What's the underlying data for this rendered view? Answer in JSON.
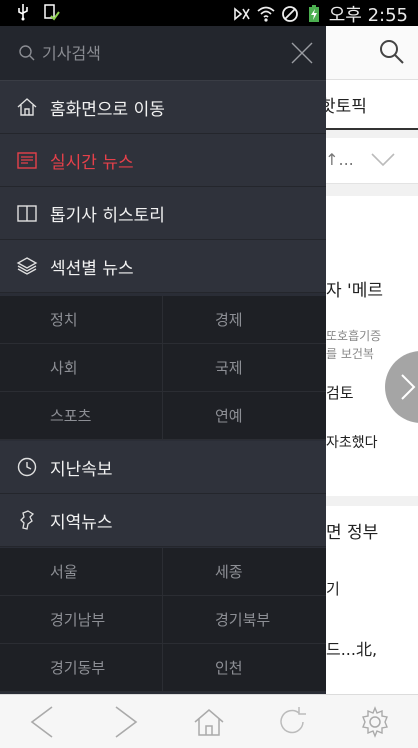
{
  "statusbar": {
    "time": "오후 2:55",
    "icons": [
      "usb-icon",
      "download-done-icon",
      "mute-icon",
      "wifi-icon",
      "block-icon",
      "battery-charging-icon"
    ]
  },
  "background_page": {
    "tab_label": "핫토픽",
    "select_value": "·↑...",
    "snippets": [
      "자 '메르",
      "또호흡기증",
      "를 보건복",
      "검토",
      "자초했다",
      "면 정부",
      "기",
      "드...北,"
    ]
  },
  "drawer": {
    "search": {
      "placeholder": "기사검색"
    },
    "items": [
      {
        "label": "홈화면으로 이동",
        "icon": "home-icon",
        "active": false
      },
      {
        "label": "실시간 뉴스",
        "icon": "news-realtime-icon",
        "active": true
      },
      {
        "label": "톱기사 히스토리",
        "icon": "book-icon",
        "active": false
      },
      {
        "label": "섹션별 뉴스",
        "icon": "layers-icon",
        "active": false
      },
      {
        "label": "지난속보",
        "icon": "clock-icon",
        "active": false
      },
      {
        "label": "지역뉴스",
        "icon": "map-korea-icon",
        "active": false
      }
    ],
    "sections": [
      [
        "정치",
        "경제"
      ],
      [
        "사회",
        "국제"
      ],
      [
        "스포츠",
        "연예"
      ]
    ],
    "regions": [
      [
        "서울",
        "세종"
      ],
      [
        "경기남부",
        "경기북부"
      ],
      [
        "경기동부",
        "인천"
      ]
    ]
  },
  "bottombar": {
    "buttons": [
      "back-icon",
      "forward-icon",
      "home-icon",
      "refresh-icon",
      "settings-icon"
    ]
  },
  "colors": {
    "drawer_bg": "#2a2d36",
    "active_red": "#e5404a"
  }
}
